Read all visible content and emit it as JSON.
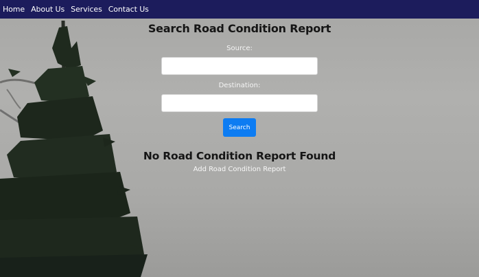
{
  "nav": {
    "items": [
      {
        "label": "Home"
      },
      {
        "label": "About Us"
      },
      {
        "label": "Services"
      },
      {
        "label": "Contact Us"
      }
    ]
  },
  "main": {
    "title": "Search Road Condition Report",
    "source_label": "Source:",
    "source_value": "",
    "destination_label": "Destination:",
    "destination_value": "",
    "search_label": "Search",
    "no_result_text": "No Road Condition Report Found",
    "add_link_label": "Add Road Condition Report"
  },
  "colors": {
    "navbar": "#1c1c5c",
    "button": "#0d7cf2",
    "background": "#a9a9a7"
  }
}
